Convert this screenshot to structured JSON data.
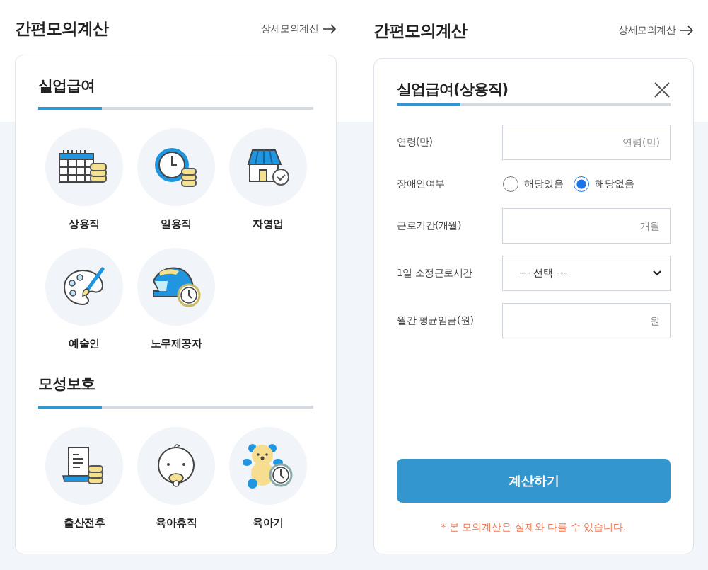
{
  "left": {
    "title": "간편모의계산",
    "link": "상세모의계산",
    "sections": [
      {
        "heading": "실업급여",
        "items": [
          {
            "label": "상용직"
          },
          {
            "label": "일용직"
          },
          {
            "label": "자영업"
          },
          {
            "label": "예술인"
          },
          {
            "label": "노무제공자"
          }
        ]
      },
      {
        "heading": "모성보호",
        "items": [
          {
            "label": "출산전후"
          },
          {
            "label": "육아휴직"
          },
          {
            "label": "육아기"
          }
        ]
      }
    ]
  },
  "right": {
    "title": "간편모의계산",
    "link": "상세모의계산",
    "form": {
      "title": "실업급여(상용직)",
      "fields": [
        {
          "kind": "input",
          "label": "연령(만)",
          "placeholder": "연령(만)"
        },
        {
          "kind": "radio",
          "label": "장애인여부",
          "options": [
            {
              "label": "해당있음",
              "selected": false
            },
            {
              "label": "해당없음",
              "selected": true
            }
          ]
        },
        {
          "kind": "input",
          "label": "근로기간(개월)",
          "placeholder": "개월"
        },
        {
          "kind": "select",
          "label": "1일 소정근로시간",
          "value": "--- 선택 ---"
        },
        {
          "kind": "input",
          "label": "월간 평균임금(원)",
          "placeholder": "원"
        }
      ],
      "button": "계산하기",
      "note": "* 본 모의계산은 실제와 다를 수 있습니다."
    }
  }
}
